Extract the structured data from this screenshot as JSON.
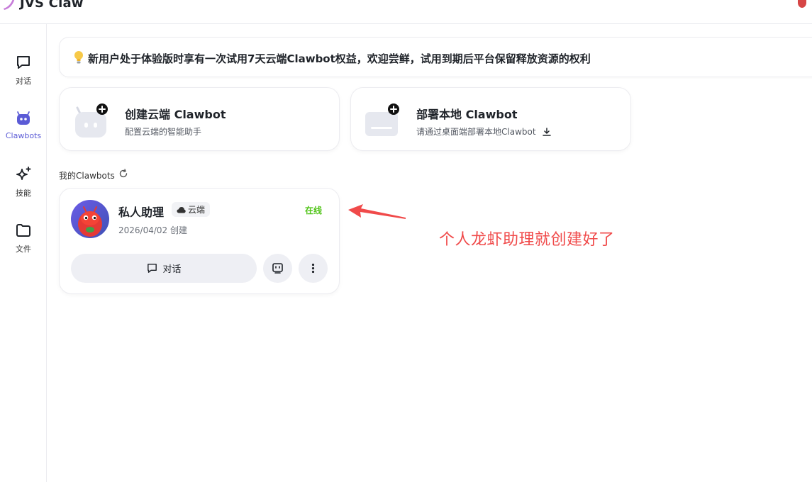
{
  "app": {
    "title": "JVS Claw"
  },
  "sidebar": {
    "items": [
      {
        "label": "对话",
        "icon": "chat-bubble-icon",
        "active": false
      },
      {
        "label": "Clawbots",
        "icon": "robot-icon",
        "active": true
      },
      {
        "label": "技能",
        "icon": "sparkle-icon",
        "active": false
      },
      {
        "label": "文件",
        "icon": "folder-icon",
        "active": false
      }
    ]
  },
  "banner": {
    "icon": "lightbulb-icon",
    "text": "新用户处于体验版时享有一次试用7天云端Clawbot权益，欢迎尝鲜，试用到期后平台保留释放资源的权利"
  },
  "actions": {
    "create": {
      "title": "创建云端 Clawbot",
      "subtitle": "配置云端的智能助手",
      "icon": "robot-add-icon"
    },
    "deploy": {
      "title": "部署本地 Clawbot",
      "subtitle": "请通过桌面端部署本地Clawbot",
      "icon": "monitor-add-icon"
    }
  },
  "section": {
    "title": "我的Clawbots"
  },
  "bots": [
    {
      "name": "私人助理",
      "tag": "云端",
      "status": "在线",
      "created": "2026/04/02 创建",
      "chat_label": "对话"
    }
  ],
  "annotation": {
    "text": "个人龙虾助理就创建好了"
  },
  "colors": {
    "accent": "#5b5bd6",
    "online": "#52c41a",
    "annotation": "#f04a4a",
    "button_bg": "#eeeff4"
  }
}
